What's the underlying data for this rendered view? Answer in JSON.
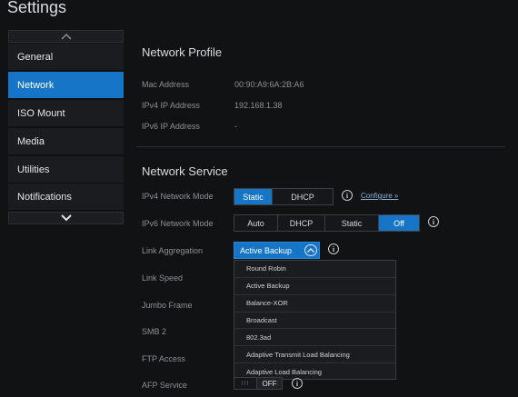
{
  "header": {
    "title": "Settings"
  },
  "sidebar": {
    "items": [
      {
        "label": "General"
      },
      {
        "label": "Network"
      },
      {
        "label": "ISO Mount"
      },
      {
        "label": "Media"
      },
      {
        "label": "Utilities"
      },
      {
        "label": "Notifications"
      }
    ],
    "active": "Network"
  },
  "network_profile": {
    "title": "Network Profile",
    "mac_label": "Mac Address",
    "mac_value": "00:90:A9:6A:2B:A6",
    "ipv4_label": "IPv4 IP Address",
    "ipv4_value": "192.168.1.38",
    "ipv6_label": "IPv6 IP Address",
    "ipv6_value": "-"
  },
  "network_service": {
    "title": "Network Service",
    "ipv4_mode_label": "IPv4 Network Mode",
    "ipv4_mode_options": [
      "Static",
      "DHCP"
    ],
    "ipv4_mode_selected": "Static",
    "configure_link": "Configure »",
    "ipv6_mode_label": "IPv6 Network Mode",
    "ipv6_mode_options": [
      "Auto",
      "DHCP",
      "Static",
      "Off"
    ],
    "ipv6_mode_selected": "Off",
    "link_aggregation_label": "Link Aggregation",
    "link_aggregation_value": "Active Backup",
    "link_aggregation_options": [
      "Round Robin",
      "Active Backup",
      "Balance-XOR",
      "Broadcast",
      "802.3ad",
      "Adaptive Transmit Load Balancing",
      "Adaptive Load Balancing"
    ],
    "link_speed_label": "Link Speed",
    "jumbo_frame_label": "Jumbo Frame",
    "smb2_label": "SMB 2",
    "ftp_label": "FTP Access",
    "afp_label": "AFP Service",
    "afp_grip": "III",
    "afp_state": "OFF"
  },
  "icons": {
    "info": "i"
  },
  "colors": {
    "accent": "#1775c7",
    "background": "#111214"
  }
}
